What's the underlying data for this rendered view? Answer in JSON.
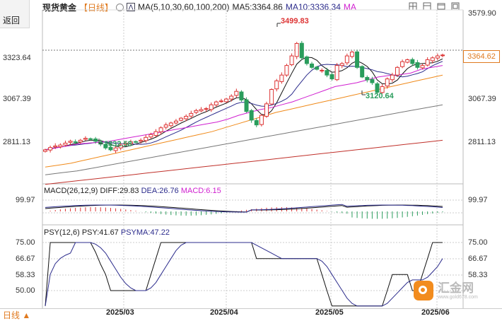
{
  "header": {
    "instrument": "现货黄金",
    "period": "【日线】",
    "period_icon": "circle-icon",
    "ma_label": "MA(5,10,30,60,100,200)",
    "ma5": "MA5:3364.86",
    "ma10": "MA10:3336.34",
    "ma_extra": "MA"
  },
  "back_button": {
    "label": "返回"
  },
  "price_axis": {
    "right": [
      "3579.90",
      "3323.64",
      "3067.39",
      "2811.13"
    ],
    "left": [
      "3323.64",
      "3067.39",
      "2811.13"
    ],
    "current_price": "3364.62"
  },
  "annotations": {
    "high": "3499.83",
    "low_recent": "3120.64",
    "low_early": "2832.58"
  },
  "macd": {
    "label": "MACD(26,12,9)",
    "diff": "DIFF:29.83",
    "dea": "DEA:26.76",
    "macd": "MACD:6.15",
    "axis_left": "99.97",
    "axis_right": "99.97"
  },
  "psy": {
    "label": "PSY(12,6)",
    "psy": "PSY:41.67",
    "psyma": "PSYMA:47.22",
    "axis": [
      "75.00",
      "66.67",
      "58.33",
      "50.00"
    ]
  },
  "dates": [
    "2025/03",
    "2025/04",
    "2025/05",
    "2025/06"
  ],
  "footer": {
    "period_select": "日线 ▲"
  },
  "logo": {
    "text": "汇金网",
    "sub": "www.gold678.com"
  },
  "colors": {
    "up": "#d33",
    "down": "#2a9d5c",
    "ma5": "#111111",
    "ma10": "#2c2c8c",
    "ma30": "#d01fd0",
    "ma60": "#f08a1a",
    "ma100": "#777777",
    "ma200": "#c0302a"
  },
  "chart_data": {
    "type": "candlestick",
    "title": "现货黄金【日线】",
    "ylim": [
      2700,
      3600
    ],
    "x_ticks": [
      "2025/03",
      "2025/04",
      "2025/05",
      "2025/06"
    ],
    "annotations": [
      {
        "label": "3499.83",
        "value": 3499.83
      },
      {
        "label": "3120.64",
        "value": 3120.64
      },
      {
        "label": "2832.58",
        "value": 2832.58
      }
    ],
    "closes": [
      2870,
      2882,
      2890,
      2895,
      2905,
      2915,
      2910,
      2920,
      2930,
      2925,
      2915,
      2900,
      2880,
      2870,
      2880,
      2895,
      2905,
      2912,
      2910,
      2920,
      2935,
      2950,
      2965,
      2985,
      3000,
      3010,
      3020,
      3035,
      3045,
      3060,
      3075,
      3080,
      3085,
      3105,
      3120,
      3125,
      3135,
      3150,
      3175,
      3130,
      3070,
      3025,
      3000,
      3050,
      3110,
      3185,
      3230,
      3260,
      3310,
      3360,
      3425,
      3350,
      3320,
      3300,
      3290,
      3285,
      3260,
      3240,
      3310,
      3320,
      3360,
      3380,
      3300,
      3250,
      3235,
      3220,
      3170,
      3200,
      3240,
      3260,
      3300,
      3330,
      3340,
      3320,
      3300,
      3310,
      3340,
      3350,
      3360,
      3364.62
    ],
    "ma_series": [
      {
        "name": "MA30",
        "values": [
          2870,
          2880,
          2890,
          2900,
          2905,
          2910,
          2915,
          2925,
          2935,
          2945,
          2955,
          2965,
          2975,
          2985,
          2995,
          3005,
          3015,
          3030,
          3050,
          3065,
          3080,
          3090,
          3105,
          3120,
          3140,
          3160,
          3180,
          3200,
          3210,
          3220,
          3235,
          3250,
          3258,
          3262,
          3270,
          3290,
          3300,
          3310
        ]
      },
      {
        "name": "MA60",
        "values": [
          2780,
          2790,
          2800,
          2815,
          2830,
          2845,
          2860,
          2875,
          2890,
          2905,
          2920,
          2935,
          2950,
          2965,
          2985,
          3005,
          3025,
          3045,
          3065,
          3080,
          3095,
          3110,
          3125,
          3140,
          3155,
          3170,
          3185,
          3200,
          3215,
          3230,
          3245,
          3260
        ]
      },
      {
        "name": "MA100",
        "values": [
          2740,
          2750,
          2760,
          2775,
          2790,
          2805,
          2820,
          2835,
          2850,
          2865,
          2880,
          2895,
          2910,
          2925,
          2940,
          2955,
          2970,
          2985,
          3000,
          3015,
          3030,
          3045,
          3060,
          3075,
          3090,
          3105
        ]
      },
      {
        "name": "MA200",
        "values": [
          2690,
          2700,
          2710,
          2720,
          2730,
          2740,
          2750,
          2760,
          2770,
          2780,
          2790,
          2800,
          2810,
          2820,
          2830,
          2840,
          2850,
          2860,
          2870,
          2880,
          2890,
          2900,
          2910,
          2920
        ]
      }
    ],
    "macd": {
      "diff": 29.83,
      "dea": 26.76,
      "macd": 6.15
    },
    "psy": {
      "psy": 41.67,
      "psyma": 47.22
    }
  }
}
